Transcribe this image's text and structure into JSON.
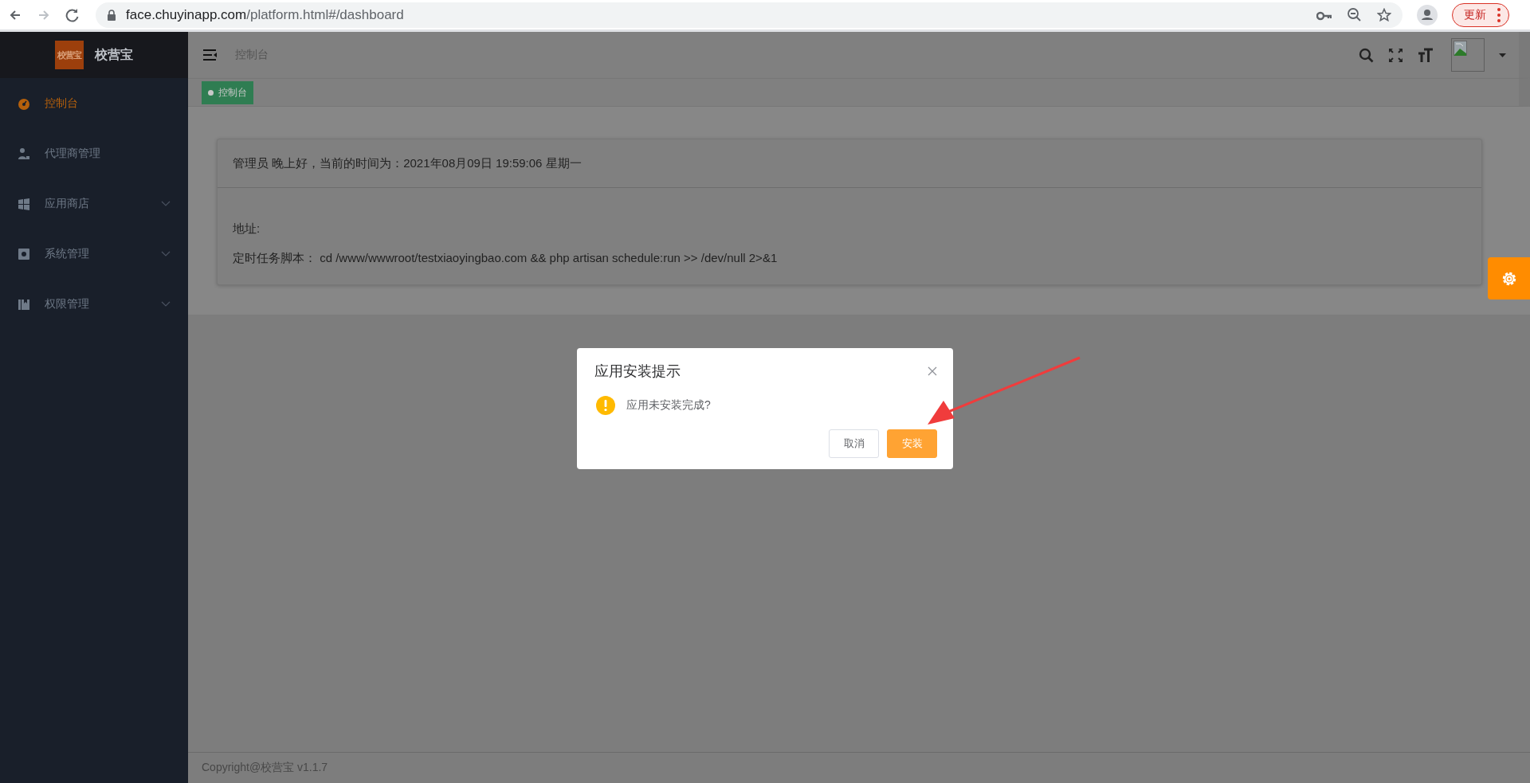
{
  "browser": {
    "back_enabled": true,
    "forward_enabled": false,
    "url_host": "face.chuyinapp.com",
    "url_path": "/platform.html#/dashboard",
    "update_button": "更新"
  },
  "sidebar": {
    "logo_badge": "校营宝",
    "title": "校营宝",
    "items": [
      {
        "label": "控制台",
        "selected": true,
        "expandable": false
      },
      {
        "label": "代理商管理",
        "selected": false,
        "expandable": false
      },
      {
        "label": "应用商店",
        "selected": false,
        "expandable": true
      },
      {
        "label": "系统管理",
        "selected": false,
        "expandable": true
      },
      {
        "label": "权限管理",
        "selected": false,
        "expandable": true
      }
    ]
  },
  "topbar": {
    "breadcrumb": "控制台"
  },
  "tags": [
    {
      "label": "控制台",
      "selected": true
    }
  ],
  "card": {
    "greeting": "管理员 晚上好，当前的时间为：2021年08月09日 19:59:06 星期一",
    "lines": [
      "地址:",
      "定时任务脚本： cd /www/wwwroot/testxiaoyingbao.com && php artisan schedule:run >> /dev/null 2>&1"
    ]
  },
  "footer": "Copyright@校营宝 v1.1.7",
  "dialog": {
    "title": "应用安装提示",
    "message": "应用未安装完成?",
    "buttons": [
      {
        "label": "取消",
        "kind": "default"
      },
      {
        "label": "安装",
        "kind": "primary"
      }
    ]
  }
}
